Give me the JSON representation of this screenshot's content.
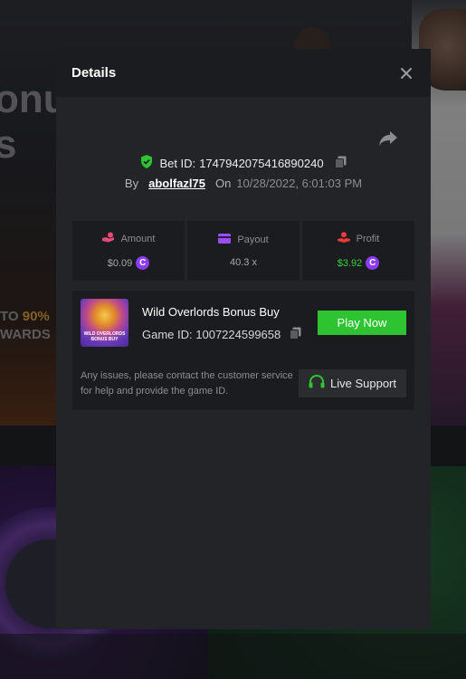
{
  "background": {
    "big_text_line1": "onus",
    "big_text_line2": "s",
    "promo_prefix": "TO ",
    "promo_highlight": "90%",
    "promo_line2": "WARDS"
  },
  "modal": {
    "title": "Details",
    "bet_label": "Bet ID:",
    "bet_id": "1747942075416890240",
    "by_label": "By",
    "username": "abolfazl75",
    "on_label": "On",
    "date": "10/28/2022, 6:01:03 PM"
  },
  "stats": {
    "amount_label": "Amount",
    "amount_value": "$0.09",
    "payout_label": "Payout",
    "payout_value": "40.3 x",
    "profit_label": "Profit",
    "profit_value": "$3.92"
  },
  "game": {
    "name": "Wild Overlords Bonus Buy",
    "thumb_title": "WILD OVERLORDS BONUS BUY",
    "id_label": "Game ID:",
    "game_id": "1007224599658",
    "play_label": "Play Now",
    "help_text": "Any issues, please contact the customer service for help and provide the game ID.",
    "support_label": "Live Support"
  },
  "colors": {
    "accent_green": "#2ec431",
    "profit_green": "#39d23d",
    "coin_purple": "#8b3cf0",
    "amount_pink": "#e84a7a",
    "payout_purple": "#9a4df0",
    "profit_red": "#e83c3c"
  },
  "icons": [
    "close-icon",
    "share-icon",
    "shield-check-icon",
    "copy-icon",
    "coin-icon",
    "hand-coin-icon",
    "wallet-icon",
    "profit-icon",
    "headset-icon"
  ]
}
